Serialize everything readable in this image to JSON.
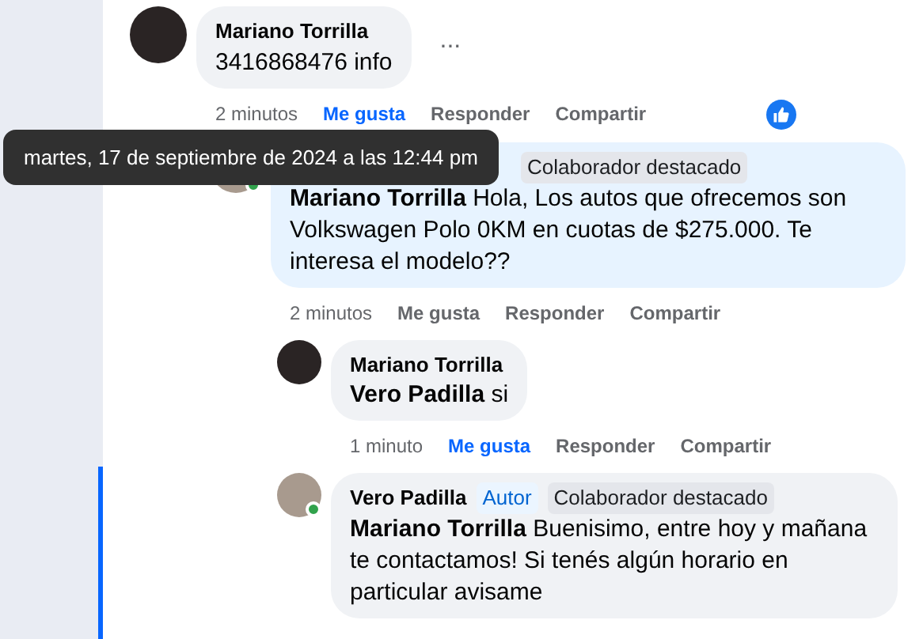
{
  "comments": [
    {
      "author": "Mariano Torrilla",
      "text": "3416868476 info",
      "highlighted": false,
      "more": "...",
      "time": "2 minutos",
      "like": {
        "label": "Me gusta",
        "selected": true
      },
      "reply": "Responder",
      "share": "Compartir",
      "reacted": true,
      "replies": [
        {
          "badges": [
            {
              "label": "Colaborador destacado",
              "kind": "top"
            }
          ],
          "mention": "Mariano Torrilla",
          "text": "Hola, Los autos que ofrecemos son Volkswagen Polo 0KM en cuotas de $275.000. Te interesa el modelo??",
          "online": true,
          "highlighted": true,
          "time": "2 minutos",
          "like": {
            "label": "Me gusta",
            "selected": false
          },
          "reply": "Responder",
          "share": "Compartir",
          "replies": [
            {
              "author": "Mariano Torrilla",
              "mention": "Vero Padilla",
              "text": "si",
              "highlighted": false,
              "time": "1 minuto",
              "like": {
                "label": "Me gusta",
                "selected": true
              },
              "reply": "Responder",
              "share": "Compartir"
            },
            {
              "author": "Vero Padilla",
              "badges": [
                {
                  "label": "Autor",
                  "kind": "author"
                },
                {
                  "label": "Colaborador destacado",
                  "kind": "top"
                }
              ],
              "mention": "Mariano Torrilla",
              "text": "Buenisimo, entre hoy y mañana te contactamos! Si tenés algún horario en particular avisame",
              "online": true,
              "highlighted": false
            }
          ]
        }
      ]
    }
  ],
  "tooltip": "martes, 17 de septiembre de 2024 a las 12:44 pm"
}
